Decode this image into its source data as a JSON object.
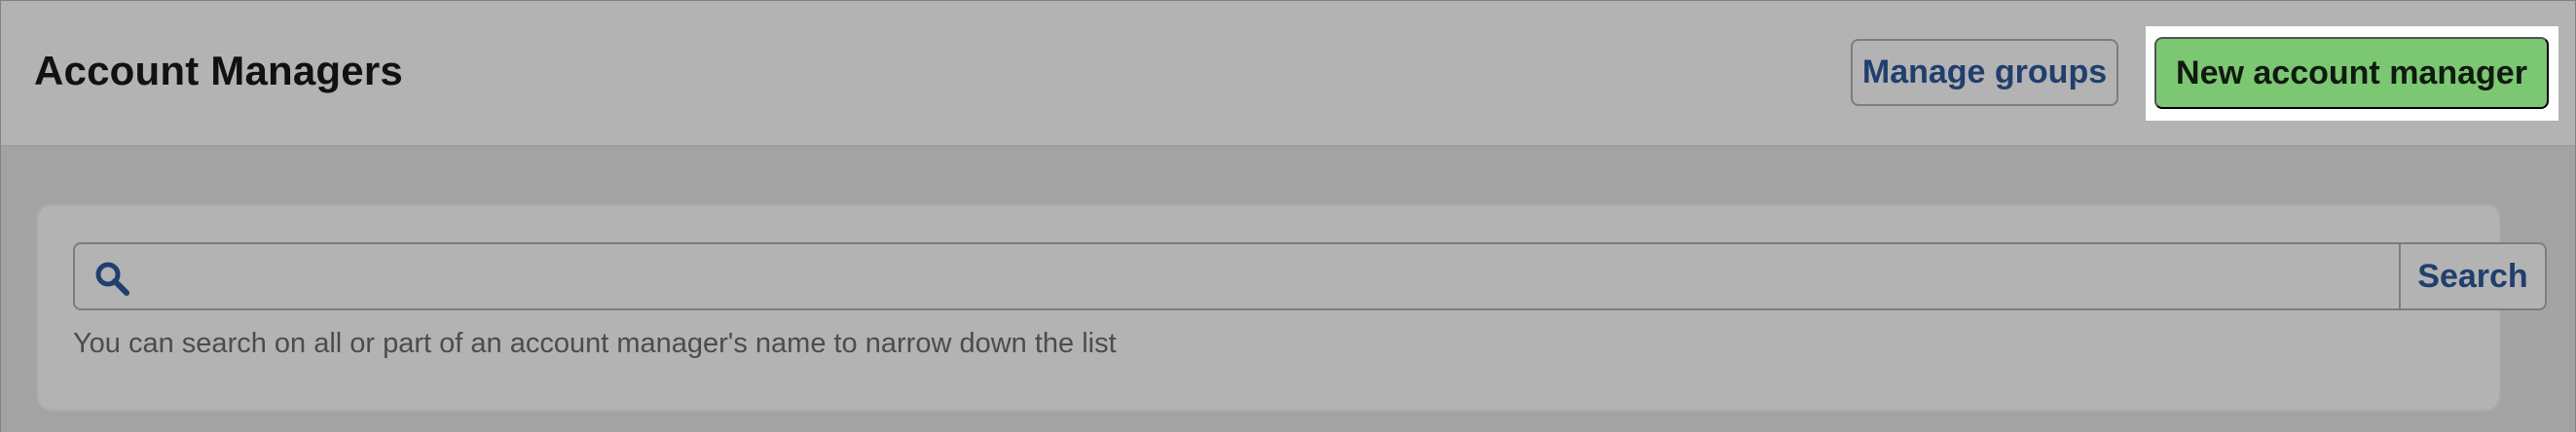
{
  "header": {
    "title": "Account Managers",
    "manage_groups_label": "Manage groups",
    "new_account_manager_label": "New account manager"
  },
  "search": {
    "value": "",
    "placeholder": "",
    "button_label": "Search",
    "help_text": "You can search on all or part of an account manager's name to narrow down the list",
    "icon": "search-icon"
  },
  "colors": {
    "page_background": "#a3a3a3",
    "header_background": "#b3b3b3",
    "primary_button": "#7cc772",
    "link_blue": "#203f6e",
    "highlight": "#ffffff"
  }
}
